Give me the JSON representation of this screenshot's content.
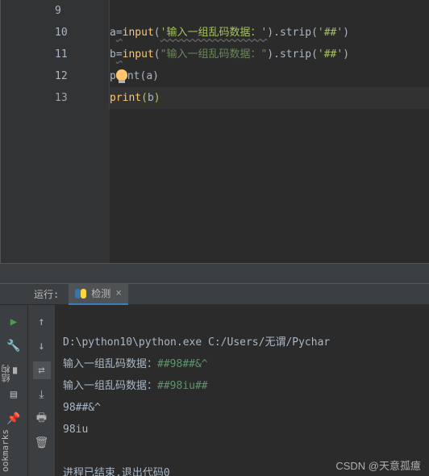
{
  "editor": {
    "gutter": [
      "9",
      "10",
      "11",
      "12",
      "13"
    ],
    "line10": {
      "a": "a",
      "eq": "=",
      "fn": "input",
      "lp": "(",
      "s": "'输入一组乱码数据：'",
      "rp": ")",
      "dot": ".",
      "m": "strip",
      "lp2": "(",
      "s2": "'##'",
      "rp2": ")"
    },
    "line11": {
      "a": "b",
      "eq": "=",
      "fn": "input",
      "lp": "(",
      "s": "\"输入一组乱码数据：\"",
      "rp": ")",
      "dot": ".",
      "m": "strip",
      "lp2": "(",
      "s2": "'##'",
      "rp2": ")"
    },
    "line12": {
      "pr": "print",
      "lp": "(",
      "v": "a",
      "rp": ")"
    },
    "line13": {
      "pr": "print",
      "lp": "(",
      "v": "b",
      "rp": ")"
    }
  },
  "run": {
    "label": "运行:",
    "tab": "检测",
    "close": "×"
  },
  "console": {
    "cmd": "D:\\python10\\python.exe C:/Users/无谓/Pychar",
    "p1": "输入一组乱码数据：",
    "i1": "##98##&^",
    "p2": "输入一组乱码数据：",
    "i2": "##98iu##",
    "o1": "98##&^",
    "o2": "98iu",
    "end": "进程已结束,退出代码0"
  },
  "side": {
    "a": "结构",
    "b": "ookmarks"
  },
  "watermark": "CSDN @天意孤癔"
}
